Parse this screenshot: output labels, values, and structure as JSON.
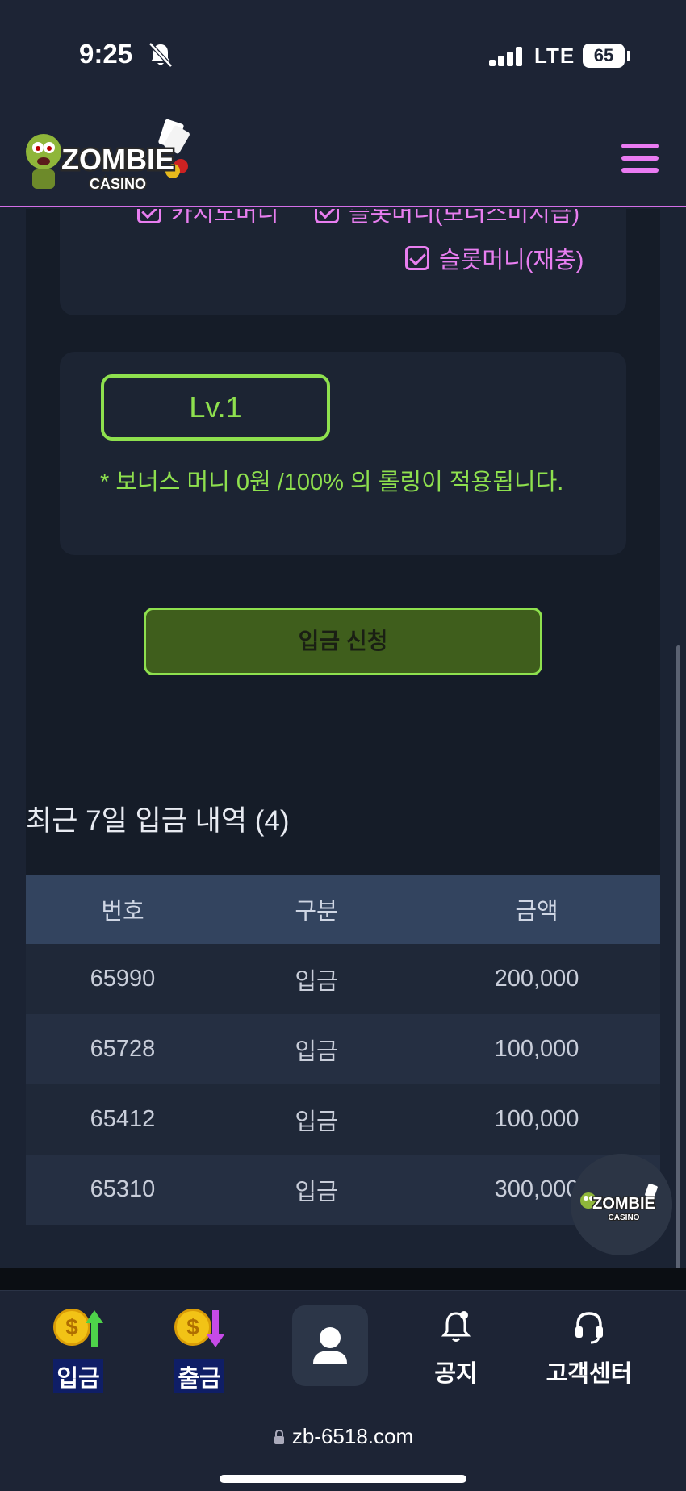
{
  "status_bar": {
    "time": "9:25",
    "network": "LTE",
    "battery": "65"
  },
  "header": {
    "logo_text": "ZOMBIE",
    "logo_subtext": "CASINO",
    "menu_icon": "hamburger-icon"
  },
  "bonus_options": {
    "partial_top_left": "카지노머니",
    "partial_top_right": "슬롯머니(보너스미지급)",
    "slot_recharge": "슬롯머니(재충)"
  },
  "level": {
    "label": "Lv.1",
    "note": "* 보너스 머니 0원 /100% 의 롤링이 적용됩니다."
  },
  "deposit_button": "입금 신청",
  "history": {
    "title": "최근 7일 입금 내역 (4)",
    "columns": [
      "번호",
      "구분",
      "금액"
    ],
    "rows": [
      {
        "no": "65990",
        "type": "입금",
        "amount": "200,000"
      },
      {
        "no": "65728",
        "type": "입금",
        "amount": "100,000"
      },
      {
        "no": "65412",
        "type": "입금",
        "amount": "100,000"
      },
      {
        "no": "65310",
        "type": "입금",
        "amount": "300,000"
      }
    ]
  },
  "bottom_nav": {
    "deposit": "입금",
    "withdraw": "출금",
    "notice": "공지",
    "support": "고객센터"
  },
  "url": "zb-6518.com",
  "colors": {
    "accent_pink": "#e87ef0",
    "accent_green": "#8ee04e",
    "bg": "#1b2333"
  }
}
